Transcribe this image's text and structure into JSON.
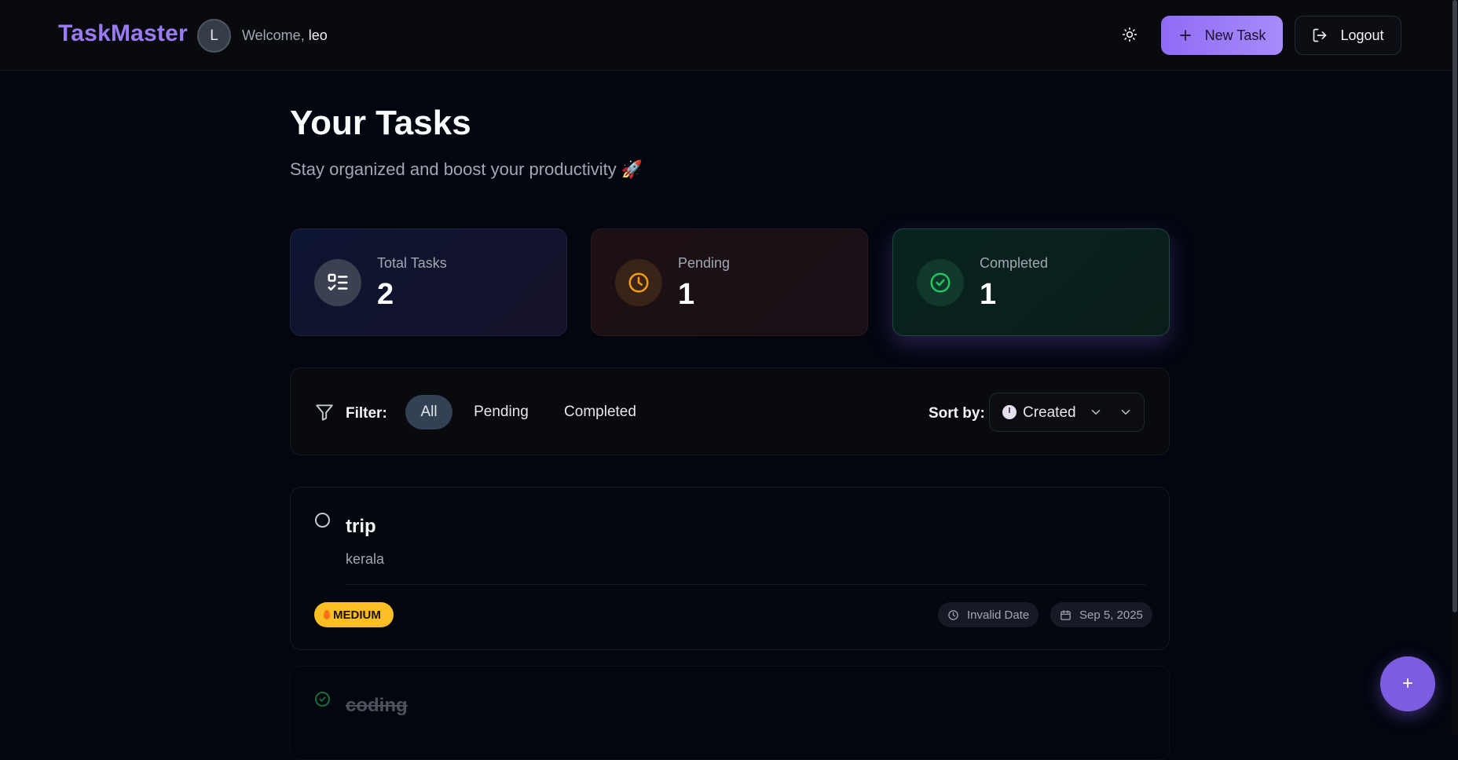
{
  "header": {
    "logo": "TaskMaster",
    "avatar_initial": "L",
    "welcome_prefix": "Welcome,",
    "username": "leo",
    "new_task_label": "New Task",
    "logout_label": "Logout",
    "theme_icon": "sun-icon"
  },
  "page": {
    "title": "Your Tasks",
    "subtitle": "Stay organized and boost your productivity 🚀"
  },
  "stats": {
    "total": {
      "label": "Total Tasks",
      "value": "2",
      "icon": "list-check-icon"
    },
    "pending": {
      "label": "Pending",
      "value": "1",
      "icon": "clock-icon"
    },
    "completed": {
      "label": "Completed",
      "value": "1",
      "icon": "check-circle-icon"
    }
  },
  "filter": {
    "label": "Filter:",
    "options": [
      "All",
      "Pending",
      "Completed"
    ],
    "selected": "All",
    "sort_label": "Sort by:",
    "sort_value": "Created"
  },
  "tasks": [
    {
      "title": "trip",
      "description": "kerala",
      "completed": false,
      "priority": "MEDIUM",
      "time": "Invalid Date",
      "date": "Sep 5, 2025"
    },
    {
      "title": "coding",
      "description": "",
      "completed": true
    }
  ],
  "fab_label": "+",
  "colors": {
    "accent": "#8b5cf6",
    "background": "#03060f",
    "priority_medium": "#fbbf24",
    "success": "#22c55e",
    "warning": "#f59e0b"
  }
}
